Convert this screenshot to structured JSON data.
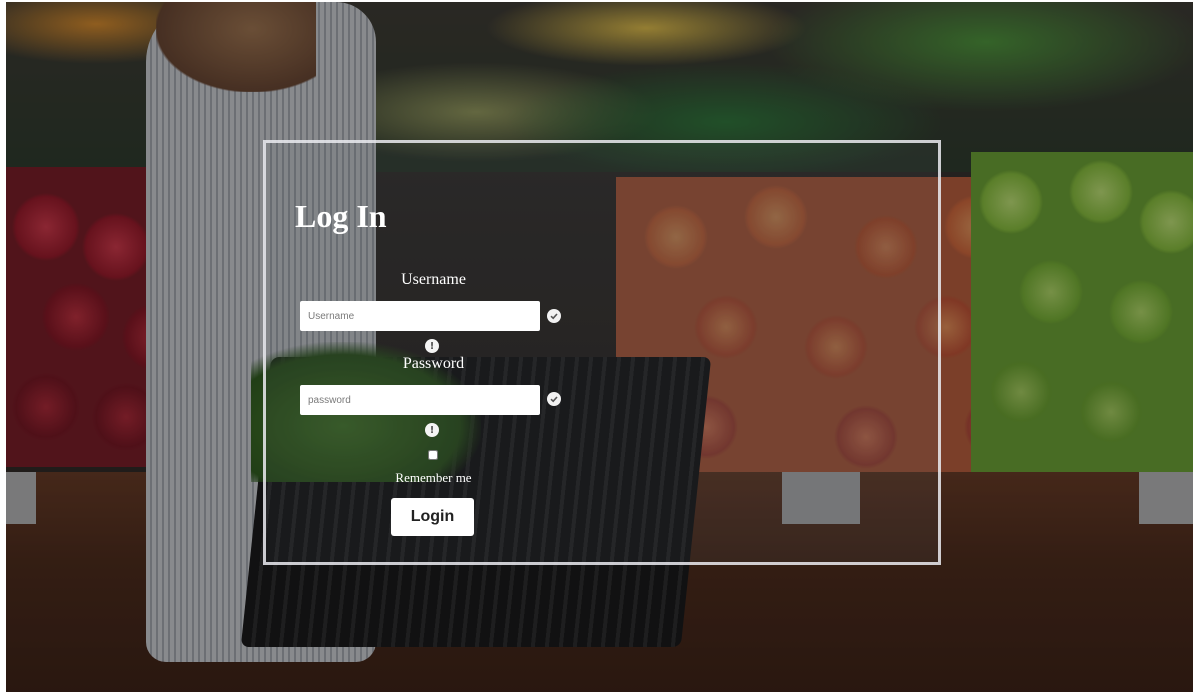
{
  "background": {
    "description_icon": "grocery-store-photo"
  },
  "login": {
    "title": "Log In",
    "username_label": "Username",
    "username_placeholder": "Username",
    "username_value": "",
    "password_label": "Password",
    "password_placeholder": "password",
    "password_value": "",
    "remember_label": "Remember me",
    "remember_checked": false,
    "button_label": "Login",
    "valid_icon": "check-circle-icon",
    "hint_icon": "info-circle-icon"
  }
}
